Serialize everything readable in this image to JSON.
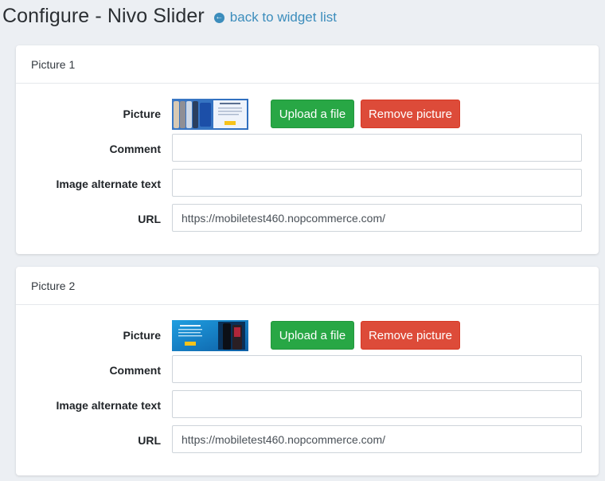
{
  "header": {
    "title": "Configure - Nivo Slider",
    "back_link": "back to widget list"
  },
  "labels": {
    "picture": "Picture",
    "comment": "Comment",
    "alt_text": "Image alternate text",
    "url": "URL",
    "upload": "Upload a file",
    "remove": "Remove picture"
  },
  "pictures": [
    {
      "title": "Picture 1",
      "comment": "",
      "alt_text": "",
      "url": "https://mobiletest460.nopcommerce.com/"
    },
    {
      "title": "Picture 2",
      "comment": "",
      "alt_text": "",
      "url": "https://mobiletest460.nopcommerce.com/"
    }
  ],
  "colors": {
    "accent": "#3c8dbc",
    "upload_button": "#28a745",
    "remove_button": "#dd4b39",
    "background": "#eceff3"
  },
  "icons": {
    "back": "arrow-circle-left-icon"
  }
}
